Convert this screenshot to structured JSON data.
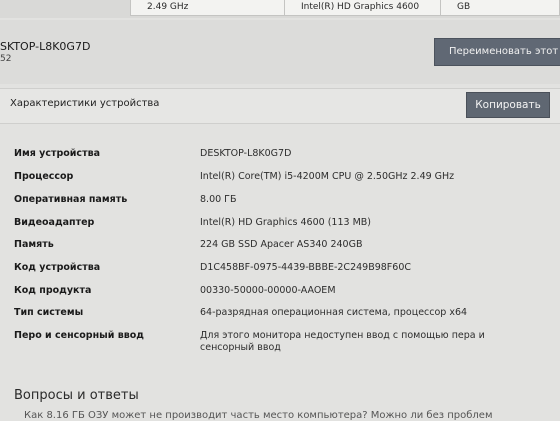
{
  "top_cards": [
    {
      "text": "2.49 GHz"
    },
    {
      "text": "Intel(R) HD Graphics 4600"
    },
    {
      "text": "GB"
    }
  ],
  "header": {
    "pc_name": "SKTOP-L8K0G7D",
    "pc_sub": "52",
    "rename_label": "Переименовать этот П"
  },
  "specs_section": {
    "title": "Характеристики устройства",
    "copy_label": "Копировать",
    "rows": [
      {
        "label": "Имя устройства",
        "value": "DESKTOP-L8K0G7D"
      },
      {
        "label": "Процессор",
        "value": "Intel(R) Core(TM) i5-4200M CPU @ 2.50GHz   2.49 GHz"
      },
      {
        "label": "Оперативная память",
        "value": "8.00 ГБ"
      },
      {
        "label": "Видеоадаптер",
        "value": "Intel(R) HD Graphics 4600 (113 MB)"
      },
      {
        "label": "Память",
        "value": "224 GB SSD Apacer AS340 240GB"
      },
      {
        "label": "Код устройства",
        "value": "D1C458BF-0975-4439-BBBE-2C249B98F60C"
      },
      {
        "label": "Код продукта",
        "value": "00330-50000-00000-AAOEM"
      },
      {
        "label": "Тип системы",
        "value": "64-разрядная операционная система, процессор x64"
      },
      {
        "label": "Перо и сенсорный ввод",
        "value": "Для этого монитора недоступен ввод с помощью пера и сенсорный ввод"
      }
    ]
  },
  "faq": {
    "title": "Вопросы и ответы",
    "partial_text": "Как 8.16 ГБ ОЗУ может не производит часть место компьютера? Можно ли без проблем"
  }
}
